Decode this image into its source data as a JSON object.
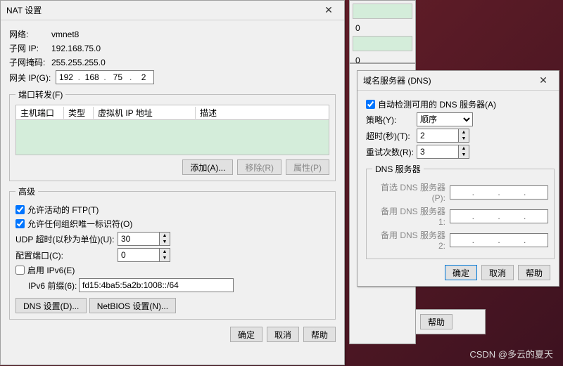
{
  "nat": {
    "title": "NAT 设置",
    "net_lab": "网络:",
    "net_val": "vmnet8",
    "subip_lab": "子网 IP:",
    "subip_val": "192.168.75.0",
    "mask_lab": "子网掩码:",
    "mask_val": "255.255.255.0",
    "gw_lab": "网关 IP(G):",
    "gw": {
      "a": "192",
      "b": "168",
      "c": "75",
      "d": "2"
    },
    "pf_legend": "端口转发(F)",
    "pf_cols": {
      "c1": "主机端口",
      "c2": "类型",
      "c3": "虚拟机 IP 地址",
      "c4": "描述"
    },
    "btn_add": "添加(A)...",
    "btn_del": "移除(R)",
    "btn_prop": "属性(P)",
    "adv_legend": "高级",
    "cb_ftp": "允许活动的 FTP(T)",
    "cb_oui": "允许任何组织唯一标识符(O)",
    "udp_lab": "UDP 超时(以秒为单位)(U):",
    "udp_val": "30",
    "cfgport_lab": "配置端口(C):",
    "cfgport_val": "0",
    "cb_ipv6": "启用 IPv6(E)",
    "ipv6pre_lab": "IPv6 前缀(6):",
    "ipv6pre_val": "fd15:4ba5:5a2b:1008::/64",
    "btn_dns": "DNS 设置(D)...",
    "btn_nb": "NetBIOS 设置(N)...",
    "btn_ok": "确定",
    "btn_cancel": "取消",
    "btn_help": "帮助"
  },
  "dns": {
    "title": "域名服务器 (DNS)",
    "cb_auto": "自动检测可用的 DNS 服务器(A)",
    "policy_lab": "策略(Y):",
    "policy_val": "顺序",
    "to_lab": "超时(秒)(T):",
    "to_val": "2",
    "retry_lab": "重试次数(R):",
    "retry_val": "3",
    "srv_legend": "DNS 服务器",
    "pref_lab": "首选 DNS 服务器(P):",
    "alt1_lab": "备用 DNS 服务器 1:",
    "alt2_lab": "备用 DNS 服务器 2:",
    "btn_ok": "确定",
    "btn_cancel": "取消",
    "btn_help": "帮助"
  },
  "bg": {
    "v0": "0",
    "v1": "0",
    "btn_help": "帮助"
  },
  "watermark": "CSDN @多云的夏天"
}
